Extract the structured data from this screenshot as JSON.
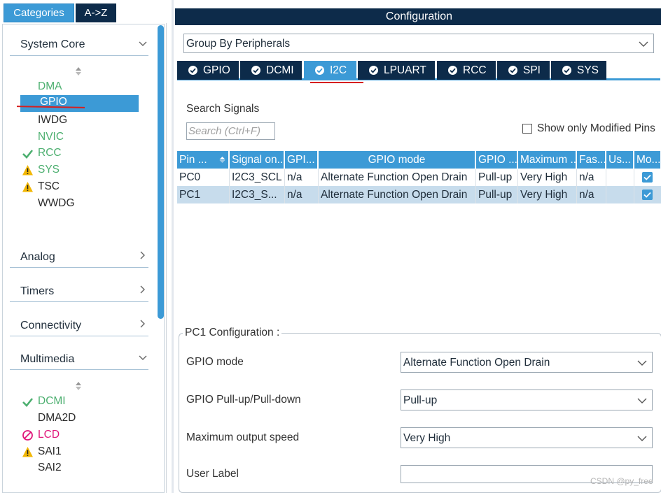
{
  "left": {
    "tabs": {
      "categories": "Categories",
      "az": "A->Z"
    },
    "system_core": {
      "title": "System Core",
      "items": [
        {
          "label": "DMA",
          "status": "enabled"
        },
        {
          "label": "GPIO",
          "status": "selected"
        },
        {
          "label": "IWDG",
          "status": "none"
        },
        {
          "label": "NVIC",
          "status": "enabled"
        },
        {
          "label": "RCC",
          "status": "ok"
        },
        {
          "label": "SYS",
          "status": "warning"
        },
        {
          "label": "TSC",
          "status": "warning"
        },
        {
          "label": "WWDG",
          "status": "none"
        }
      ]
    },
    "sections": {
      "analog": "Analog",
      "timers": "Timers",
      "connectivity": "Connectivity",
      "multimedia": "Multimedia"
    },
    "multimedia_items": [
      {
        "label": "DCMI",
        "status": "ok"
      },
      {
        "label": "DMA2D",
        "status": "none"
      },
      {
        "label": "LCD",
        "status": "disabled"
      },
      {
        "label": "SAI1",
        "status": "warning"
      },
      {
        "label": "SAI2",
        "status": "none"
      }
    ]
  },
  "right": {
    "header": "Configuration",
    "group_by": "Group By Peripherals",
    "peripheral_tabs": [
      "GPIO",
      "DCMI",
      "I2C",
      "LPUART",
      "RCC",
      "SPI",
      "SYS"
    ],
    "active_tab": "I2C",
    "search": {
      "title": "Search Signals",
      "placeholder": "Search (Ctrl+F)"
    },
    "show_modified": "Show only Modified Pins",
    "table": {
      "headers": [
        "Pin ...",
        "Signal on...",
        "GPI...",
        "GPIO mode",
        "GPIO ...",
        "Maximum ...",
        "Fas...",
        "Us...",
        "Mo..."
      ],
      "rows": [
        {
          "pin": "PC0",
          "signal": "I2C3_SCL",
          "gpio_out": "n/a",
          "mode": "Alternate Function Open Drain",
          "pull": "Pull-up",
          "speed": "Very High",
          "fast": "n/a",
          "user": "",
          "modified": true
        },
        {
          "pin": "PC1",
          "signal": "I2C3_S...",
          "gpio_out": "n/a",
          "mode": "Alternate Function Open Drain",
          "pull": "Pull-up",
          "speed": "Very High",
          "fast": "n/a",
          "user": "",
          "modified": true
        }
      ]
    },
    "pin_config": {
      "title": "PC1 Configuration :",
      "gpio_mode_label": "GPIO mode",
      "gpio_mode_value": "Alternate Function Open Drain",
      "pull_label": "GPIO Pull-up/Pull-down",
      "pull_value": "Pull-up",
      "speed_label": "Maximum output speed",
      "speed_value": "Very High",
      "user_label": "User Label",
      "user_value": ""
    },
    "watermark": "CSDN @py_free"
  },
  "colors": {
    "accent": "#3c9ad6",
    "navy": "#0d2b4a",
    "ok_green": "#4caf6f",
    "warning": "#f2b705",
    "disabled_pink": "#e0157a",
    "annotation_red": "#d61f1f"
  }
}
